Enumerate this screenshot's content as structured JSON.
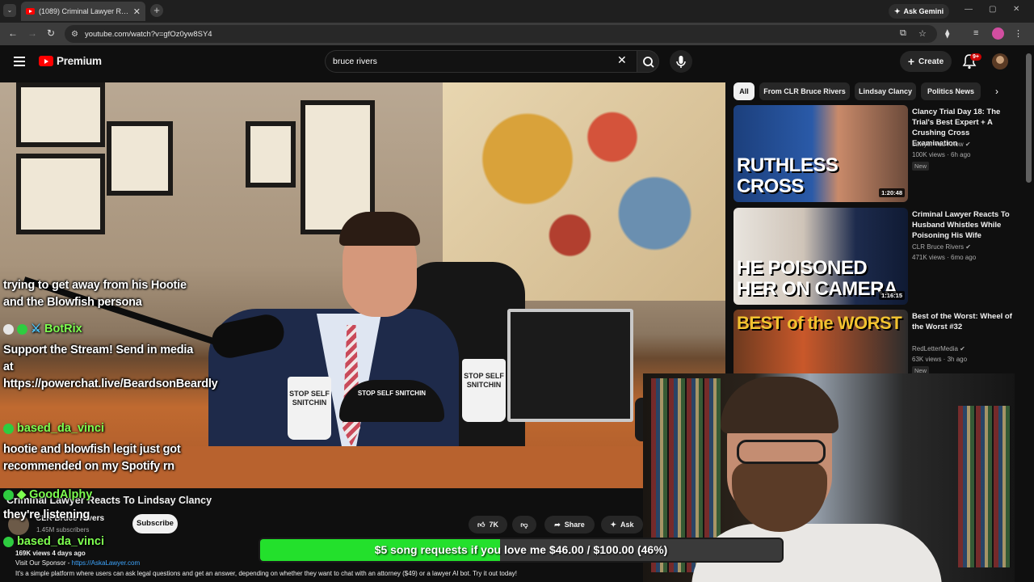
{
  "browser": {
    "tab_title": "(1089) Criminal Lawyer Reacts To",
    "tab_close": "✕",
    "new_tab": "+",
    "url": "youtube.com/watch?v=gfOz0yw8SY4",
    "gemini_label": "Ask Gemini",
    "window_controls": [
      "—",
      "▢",
      "✕"
    ]
  },
  "youtube": {
    "logo_text": "Premium",
    "search_value": "bruce rivers",
    "create_label": "Create",
    "notifications": "9+"
  },
  "video": {
    "title": "Criminal Lawyer Reacts To Lindsay Clancy",
    "channel": "CLR Bruce Rivers",
    "subscribers": "1.45M subscribers",
    "subscribe_label": "Subscribe",
    "likes": "7K",
    "share_label": "Share",
    "ask_label": "Ask",
    "views_meta": "169K views  4 days ago",
    "sponsor_prefix": "Visit Our Sponsor - ",
    "sponsor_link": "https://AskaLawyer.com",
    "description": "It's a simple platform where users can ask legal questions and get an answer, depending on whether they want to chat with an attorney ($49) or a lawyer AI bot. Try it out today!",
    "mug_text": "STOP SELF SNITCHIN",
    "hat_text": "STOP SELF SNITCHIN"
  },
  "chat": [
    {
      "user": "",
      "message": "trying to get away from his Hootie and the Blowfish persona"
    },
    {
      "user": "BotRix",
      "message": "Support the Stream! Send in media at https://powerchat.live/BeardsonBeardly"
    },
    {
      "user": "based_da_vinci",
      "message": "hootie and blowfish legit just got recommended on my Spotify rn"
    },
    {
      "user": "GoodAlphy",
      "message": "they're listening"
    },
    {
      "user": "based_da_vinci",
      "message": ""
    }
  ],
  "chips": [
    "All",
    "From CLR Bruce Rivers",
    "Lindsay Clancy",
    "Politics News"
  ],
  "recommendations": [
    {
      "title": "Clancy Trial Day 18: The Trial's Best Expert + A Crushing Cross Examination",
      "channel": "Lawyer You Know",
      "meta": "100K views · 6h ago",
      "badge": "New",
      "thumb_text": "RUTHLESS CROSS",
      "duration": "1:20:48"
    },
    {
      "title": "Criminal Lawyer Reacts To Husband Whistles While Poisoning His Wife",
      "channel": "CLR Bruce Rivers",
      "meta": "471K views · 6mo ago",
      "badge": "",
      "thumb_text": "HE POISONED HER ON CAMERA",
      "duration": "1:16:15"
    },
    {
      "title": "Best of the Worst: Wheel of the Worst #32",
      "channel": "RedLetterMedia",
      "meta": "63K views · 3h ago",
      "badge": "New",
      "thumb_text": "BEST of the WORST",
      "duration": ""
    }
  ],
  "donation": {
    "text": "$5 song requests if you love me $46.00 / $100.00 (46%)",
    "progress": 0.46,
    "fill_color": "#23e02c"
  },
  "colors": {
    "youtube_red": "#ff0000",
    "chat_name": "#7dff4f",
    "link": "#3ea6ff"
  }
}
